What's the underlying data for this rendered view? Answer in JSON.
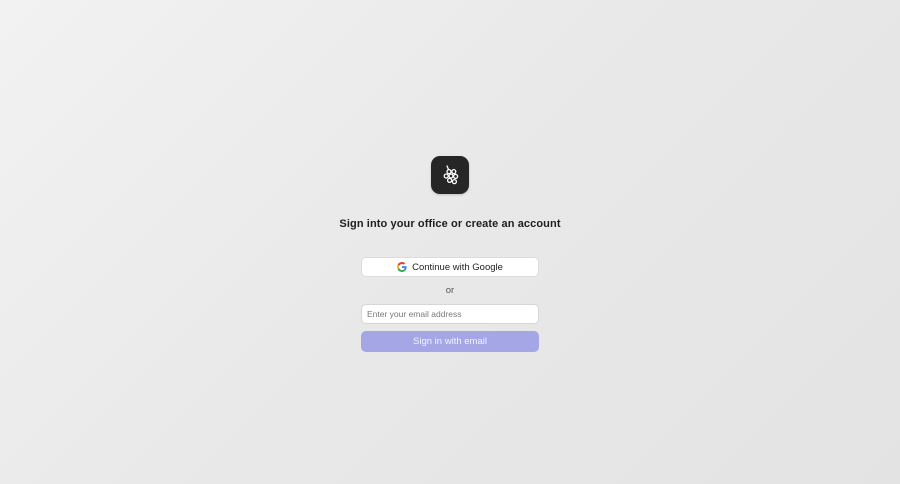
{
  "brand": {
    "logo_icon": "grapes-icon",
    "logo_background": "#262626"
  },
  "title": "Sign into your office or create an account",
  "google_button": {
    "label": "Continue with Google",
    "icon": "google-g-icon"
  },
  "divider_text": "or",
  "email": {
    "placeholder": "Enter your email address",
    "value": ""
  },
  "signin_button": {
    "label": "Sign in with email",
    "color": "#a5a6e6"
  }
}
